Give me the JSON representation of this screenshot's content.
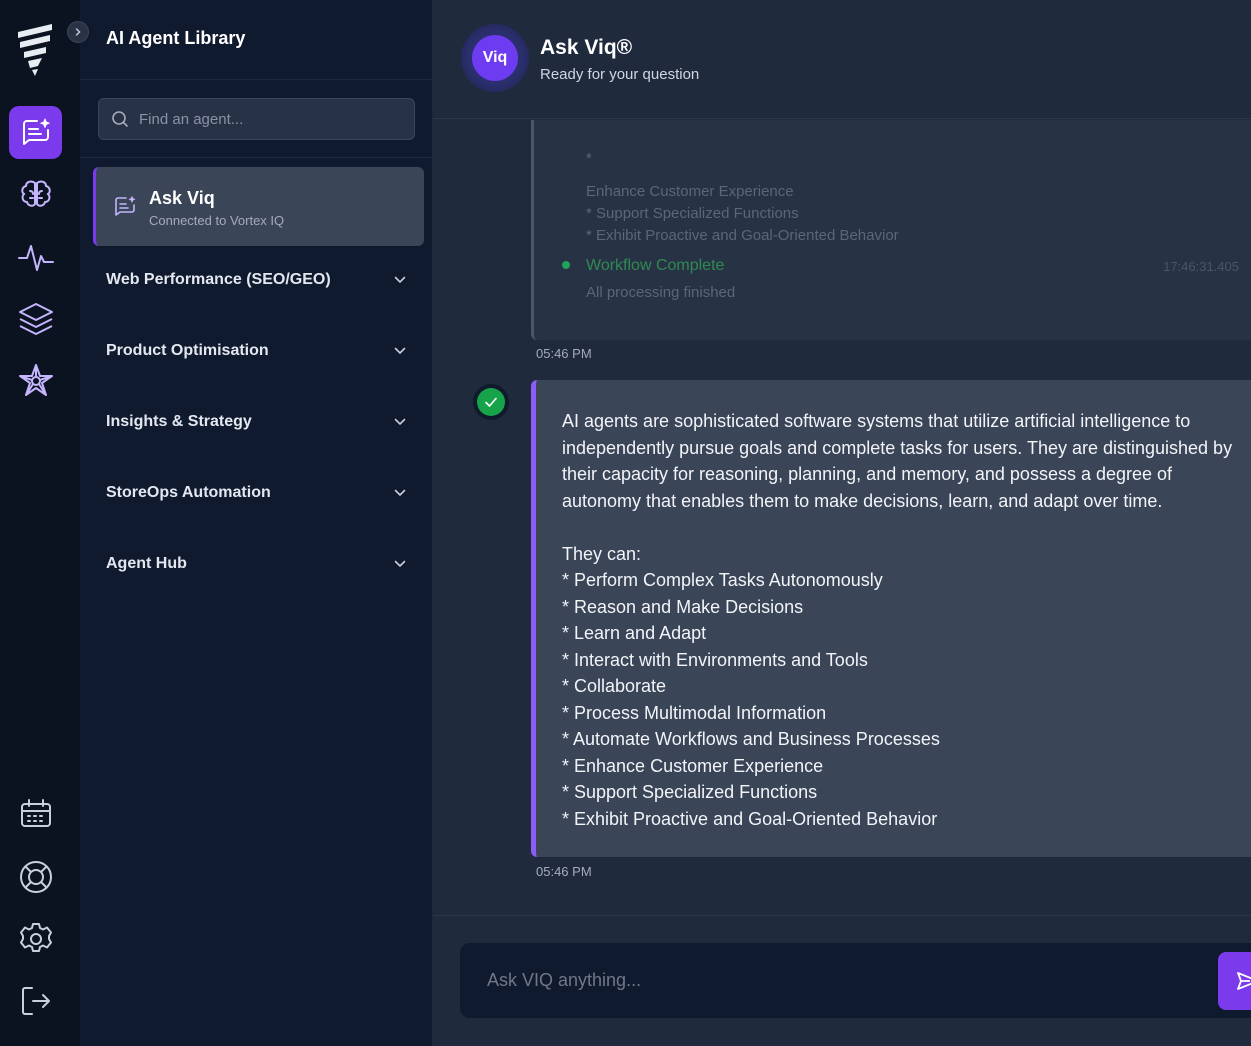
{
  "sidebar": {
    "title": "AI Agent Library",
    "search_placeholder": "Find an agent...",
    "active_agent": {
      "name": "Ask Viq",
      "status": "Connected to Vortex IQ"
    },
    "categories": [
      "Web Performance (SEO/GEO)",
      "Product Optimisation",
      "Insights & Strategy",
      "StoreOps Automation",
      "Agent Hub"
    ]
  },
  "rail": {
    "icons": [
      "logo-icon",
      "chat-sparkle-icon",
      "brain-icon",
      "activity-icon",
      "layers-icon",
      "network-star-icon",
      "calendar-icon",
      "support-icon",
      "gear-icon",
      "logout-icon"
    ],
    "accent": "#7c3aed"
  },
  "header": {
    "avatar_label": "Viq",
    "title": "Ask Viq®",
    "subtitle": "Ready for your question"
  },
  "chat": {
    "previous": {
      "lines": [
        "*",
        "Enhance Customer Experience",
        "* Support Specialized Functions",
        "* Exhibit Proactive and Goal-Oriented Behavior"
      ],
      "workflow_title": "Workflow Complete",
      "workflow_time": "17:46:31.405",
      "workflow_sub": "All processing finished",
      "time": "05:46 PM"
    },
    "reply": {
      "intro": "AI agents are sophisticated software systems that utilize artificial intelligence to independently pursue goals and complete tasks for users. They are distinguished by their capacity for reasoning, planning, and memory, and possess a degree of autonomy that enables them to make decisions, learn, and adapt over time.",
      "lead": "They can:",
      "items": [
        "* Perform Complex Tasks Autonomously",
        "* Reason and Make Decisions",
        "* Learn and Adapt",
        "* Interact with Environments and Tools",
        "* Collaborate",
        "* Process Multimodal Information",
        "* Automate Workflows and Business Processes",
        "* Enhance Customer Experience",
        "* Support Specialized Functions",
        "* Exhibit Proactive and Goal-Oriented Behavior"
      ],
      "time": "05:46 PM"
    }
  },
  "composer": {
    "placeholder": "Ask VIQ anything..."
  }
}
